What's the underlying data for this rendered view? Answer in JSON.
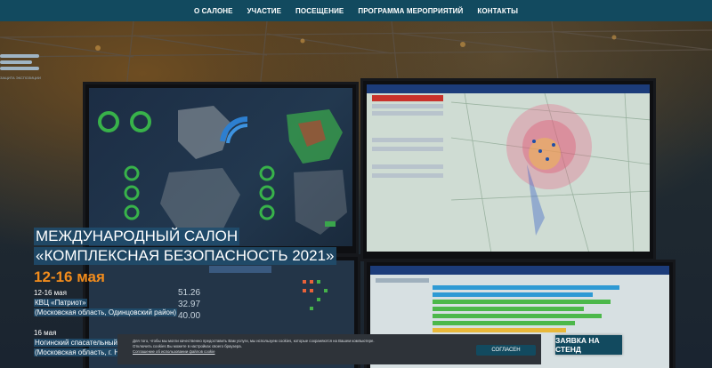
{
  "nav": {
    "items": [
      "О САЛОНЕ",
      "УЧАСТИЕ",
      "ПОСЕЩЕНИЕ",
      "ПРОГРАММА МЕРОПРИЯТИЙ",
      "КОНТАКТЫ"
    ]
  },
  "logo": {
    "caption": "ЗАЩИТА ЭКСПОЗИЦИИ"
  },
  "screens": {
    "s1_value_1": "51.26",
    "s1_value_2": "32.97",
    "s1_value_3": "40.00"
  },
  "hero": {
    "title_line_1": "МЕЖДУНАРОДНЫЙ САЛОН",
    "title_line_2": "«КОМПЛЕКСНАЯ БЕЗОПАСНОСТЬ 2021»",
    "dates": "12-16 мая",
    "venue1_dates": "12-16 мая",
    "venue1_name": "КВЦ «Патриот»",
    "venue1_place": "(Московская область, Одинцовский район)",
    "venue2_dates": "16 мая",
    "venue2_name": "Ногинский спасательный центр МЧС России",
    "venue2_place": "(Московская область, г. Ногинск)"
  },
  "cookie": {
    "text_1": "Для того, чтобы мы могли качественно предоставить Вам услуги, мы используем cookies, которые сохраняются на Вашем компьютере.",
    "text_2": "Отключить cookies Вы можете в настройках своего браузера.",
    "link": "Соглашение об использовании файлов cookie",
    "accept": "СОГЛАСЕН"
  },
  "request_button": "ЗАЯВКА НА СТЕНД",
  "colors": {
    "nav_bg": "#124a5f",
    "accent_orange": "#f28c1c",
    "title_bg": "#204e6e",
    "cookie_bg": "#2e3339"
  }
}
